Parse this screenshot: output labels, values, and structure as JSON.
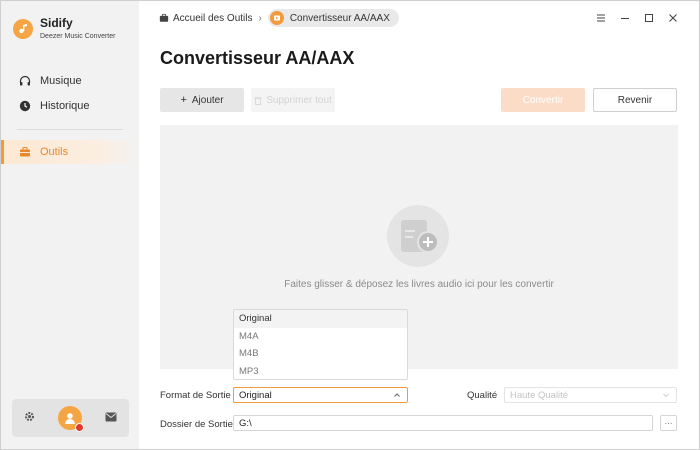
{
  "app": {
    "name": "Sidify",
    "subtitle": "Deezer Music Converter"
  },
  "sidebar": {
    "items": [
      {
        "label": "Musique",
        "icon": "headphones-icon"
      },
      {
        "label": "Historique",
        "icon": "clock-icon"
      },
      {
        "label": "Outils",
        "icon": "toolbox-icon",
        "active": true
      }
    ],
    "bottom": [
      "gear-icon",
      "avatar",
      "mail-icon"
    ]
  },
  "breadcrumb": {
    "home": "Accueil des Outils",
    "current": "Convertisseur AA/AAX"
  },
  "page": {
    "title": "Convertisseur AA/AAX"
  },
  "toolbar": {
    "add_label": "Ajouter",
    "delete_label": "Supprimer tout",
    "convert_label": "Convertir",
    "back_label": "Revenir"
  },
  "drop_area": {
    "hint": "Faites glisser & déposez les livres audio ici pour les convertir"
  },
  "format_dropdown": {
    "options": [
      "Original",
      "M4A",
      "M4B",
      "MP3"
    ],
    "selected": "Original"
  },
  "settings": {
    "format_label": "Format de Sortie",
    "format_value": "Original",
    "quality_label": "Qualité",
    "quality_value": "Haute Qualité",
    "folder_label": "Dossier de Sortie",
    "folder_value": "G:\\",
    "browse_label": "···"
  },
  "colors": {
    "accent": "#f39a3d",
    "convert_disabled": "#fbdcc7",
    "sidebar_bg": "#f2f2f2"
  }
}
